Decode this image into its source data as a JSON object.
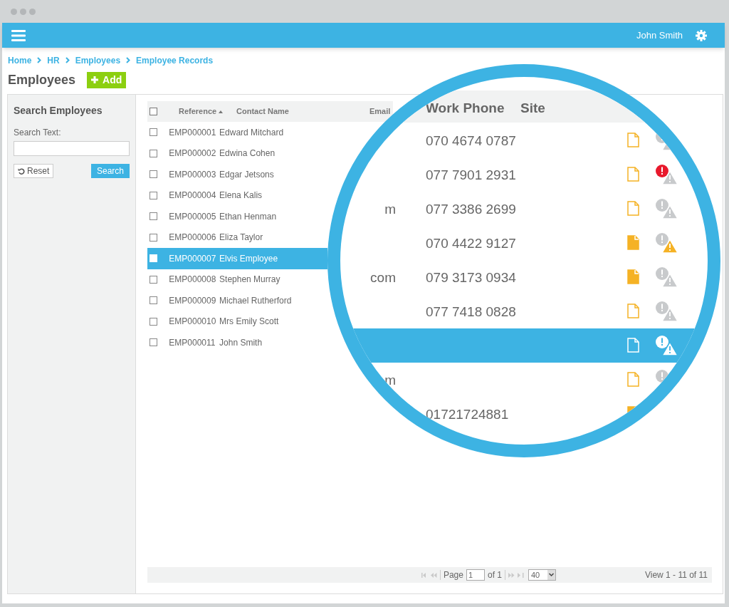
{
  "navbar": {
    "user_name": "John Smith"
  },
  "breadcrumb": [
    "Home",
    "HR",
    "Employees",
    "Employee Records"
  ],
  "page": {
    "title": "Employees",
    "add_button": "Add"
  },
  "search_panel": {
    "title": "Search Employees",
    "label": "Search Text:",
    "reset_button": "Reset",
    "search_button": "Search"
  },
  "table": {
    "all_selected": false,
    "columns": [
      {
        "label": "Reference",
        "sorted": true
      },
      {
        "label": "Contact Name",
        "sorted": false
      },
      {
        "label": "Email",
        "sorted": false
      }
    ],
    "rows": [
      {
        "reference": "EMP000001",
        "contact_name": "Edward Mitchard",
        "selected": false
      },
      {
        "reference": "EMP000002",
        "contact_name": "Edwina Cohen",
        "selected": false
      },
      {
        "reference": "EMP000003",
        "contact_name": "Edgar Jetsons",
        "selected": false
      },
      {
        "reference": "EMP000004",
        "contact_name": "Elena Kalis",
        "selected": false
      },
      {
        "reference": "EMP000005",
        "contact_name": "Ethan Henman",
        "selected": false
      },
      {
        "reference": "EMP000006",
        "contact_name": "Eliza Taylor",
        "selected": false
      },
      {
        "reference": "EMP000007",
        "contact_name": "Elvis Employee",
        "selected": true
      },
      {
        "reference": "EMP000008",
        "contact_name": "Stephen Murray",
        "selected": false
      },
      {
        "reference": "EMP000009",
        "contact_name": "Michael Rutherford",
        "selected": false
      },
      {
        "reference": "EMP000010",
        "contact_name": "Mrs Emily Scott",
        "selected": false
      },
      {
        "reference": "EMP000011",
        "contact_name": "John Smith",
        "selected": false
      }
    ]
  },
  "pager": {
    "page_label": "Page",
    "page": "1",
    "of_label": "of 1",
    "page_size": "40",
    "summary": "View 1 - 11 of 11"
  },
  "magnifier": {
    "columns": [
      "Work Phone",
      "Site"
    ],
    "rows": [
      {
        "email_fragment": "",
        "work_phone": "070 4674 0787",
        "document_filled": false,
        "error": false,
        "warning": false,
        "selected": false
      },
      {
        "email_fragment": "",
        "work_phone": "077 7901 2931",
        "document_filled": false,
        "error": true,
        "warning": false,
        "selected": false
      },
      {
        "email_fragment": "m",
        "work_phone": "077 3386 2699",
        "document_filled": false,
        "error": false,
        "warning": false,
        "selected": false
      },
      {
        "email_fragment": "",
        "work_phone": "070 4422 9127",
        "document_filled": true,
        "error": false,
        "warning": true,
        "selected": false
      },
      {
        "email_fragment": "com",
        "work_phone": "079 3173 0934",
        "document_filled": true,
        "error": false,
        "warning": false,
        "selected": false
      },
      {
        "email_fragment": "",
        "work_phone": "077 7418 0828",
        "document_filled": false,
        "error": false,
        "warning": false,
        "selected": false
      },
      {
        "email_fragment": "",
        "work_phone": "",
        "document_filled": false,
        "error": false,
        "warning": false,
        "selected": true
      },
      {
        "email_fragment": "m",
        "work_phone": "",
        "document_filled": false,
        "error": false,
        "selected": false
      },
      {
        "email_fragment": "",
        "work_phone": "01721724881",
        "document_filled": true,
        "selected": false
      }
    ]
  }
}
